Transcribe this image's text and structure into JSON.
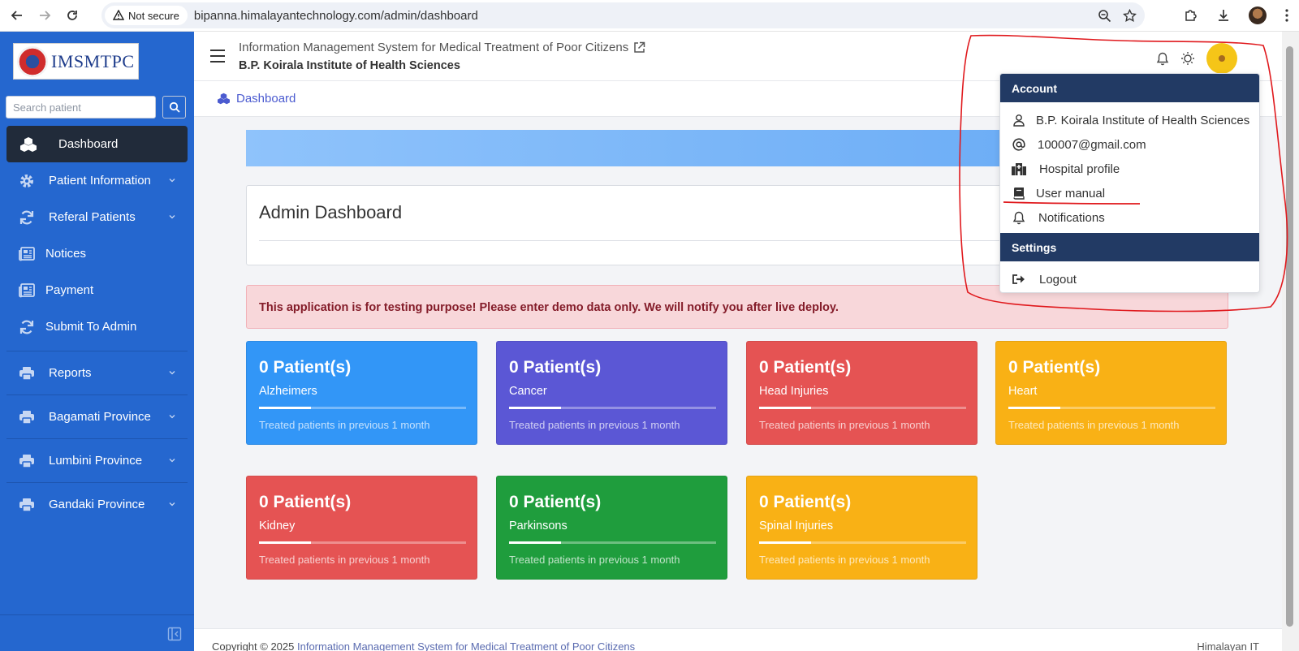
{
  "browser": {
    "security_label": "Not secure",
    "url": "bipanna.himalayantechnology.com/admin/dashboard"
  },
  "sidebar": {
    "brand": "IMSMTPC",
    "search_placeholder": "Search patient",
    "items": [
      {
        "label": "Dashboard",
        "icon": "cubes-icon",
        "active": true
      },
      {
        "label": "Patient Information",
        "icon": "gear-icon",
        "has_submenu": true
      },
      {
        "label": "Referal Patients",
        "icon": "sync-icon",
        "has_submenu": true
      },
      {
        "label": "Notices",
        "icon": "newspaper-icon"
      },
      {
        "label": "Payment",
        "icon": "newspaper-icon"
      },
      {
        "label": "Submit To Admin",
        "icon": "sync-icon"
      },
      {
        "label": "Reports",
        "icon": "print-icon",
        "has_submenu": true
      },
      {
        "label": "Bagamati Province",
        "icon": "print-icon",
        "has_submenu": true
      },
      {
        "label": "Lumbini Province",
        "icon": "print-icon",
        "has_submenu": true
      },
      {
        "label": "Gandaki Province",
        "icon": "print-icon",
        "has_submenu": true
      }
    ]
  },
  "header": {
    "system_title": "Information Management System for Medical Treatment of Poor Citizens",
    "institute": "B.P. Koirala Institute of Health Sciences"
  },
  "breadcrumb": {
    "label": "Dashboard"
  },
  "main": {
    "page_title": "Admin Dashboard",
    "alert": "This application is for testing purpose! Please enter demo data only. We will notify you after live deploy.",
    "cards": [
      {
        "count": "0 Patient(s)",
        "name": "Alzheimers",
        "desc": "Treated patients in previous 1 month",
        "color": "#3296f7",
        "progress": 0.25
      },
      {
        "count": "0 Patient(s)",
        "name": "Cancer",
        "desc": "Treated patients in previous 1 month",
        "color": "#5b57d5",
        "progress": 0.25
      },
      {
        "count": "0 Patient(s)",
        "name": "Head Injuries",
        "desc": "Treated patients in previous 1 month",
        "color": "#e55353",
        "progress": 0.25
      },
      {
        "count": "0 Patient(s)",
        "name": "Heart",
        "desc": "Treated patients in previous 1 month",
        "color": "#f9b115",
        "progress": 0.25
      },
      {
        "count": "0 Patient(s)",
        "name": "Kidney",
        "desc": "Treated patients in previous 1 month",
        "color": "#e55353",
        "progress": 0.25
      },
      {
        "count": "0 Patient(s)",
        "name": "Parkinsons",
        "desc": "Treated patients in previous 1 month",
        "color": "#1f9d3d",
        "progress": 0.25
      },
      {
        "count": "0 Patient(s)",
        "name": "Spinal Injuries",
        "desc": "Treated patients in previous 1 month",
        "color": "#f9b115",
        "progress": 0.25
      }
    ]
  },
  "dropdown": {
    "account_header": "Account",
    "items": [
      {
        "label": "B.P. Koirala Institute of Health Sciences",
        "icon": "user-icon"
      },
      {
        "label": "100007@gmail.com",
        "icon": "at-icon"
      },
      {
        "label": "Hospital profile",
        "icon": "hospital-icon"
      },
      {
        "label": "User manual",
        "icon": "book-icon"
      },
      {
        "label": "Notifications",
        "icon": "bell-icon"
      }
    ],
    "settings_header": "Settings",
    "logout_label": "Logout"
  },
  "footer": {
    "copyright_prefix": "Copyright © 2025",
    "copyright_link": "Information Management System for Medical Treatment of Poor Citizens",
    "vendor": "Himalayan IT"
  },
  "colors": {
    "sidebar": "#2567cf",
    "sidebar_active": "#212b3a",
    "dropdown_header": "#223a64",
    "annotation": "#e0191d"
  }
}
